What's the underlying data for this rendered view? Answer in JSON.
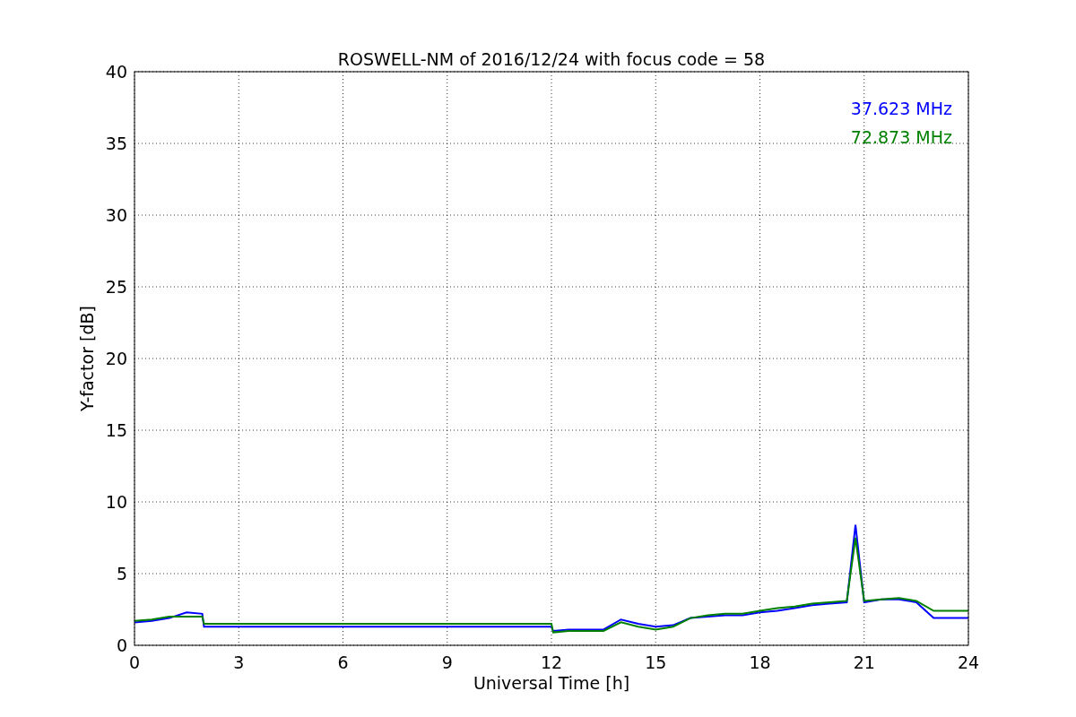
{
  "figure": {
    "chart_data": {
      "type": "line",
      "title": "ROSWELL-NM of 2016/12/24 with focus code = 58",
      "xlabel": "Universal Time [h]",
      "ylabel": "Y-factor [dB]",
      "x": [
        0,
        0.5,
        1,
        1.5,
        1.95,
        2,
        12,
        12.05,
        12.5,
        13,
        13.5,
        14,
        14.5,
        15,
        15.5,
        16,
        16.5,
        17,
        17.5,
        18,
        18.5,
        19,
        19.5,
        20,
        20.5,
        20.75,
        21,
        21.5,
        22,
        22.5,
        23,
        23.5,
        24
      ],
      "series": [
        {
          "name": "37.623 MHz",
          "color": "#0000ff",
          "values": [
            1.6,
            1.7,
            1.9,
            2.3,
            2.2,
            1.3,
            1.3,
            1.0,
            1.1,
            1.1,
            1.1,
            1.8,
            1.5,
            1.3,
            1.4,
            1.9,
            2.0,
            2.1,
            2.1,
            2.3,
            2.4,
            2.6,
            2.8,
            2.9,
            3.0,
            8.4,
            3.0,
            3.2,
            3.2,
            3.0,
            1.9,
            1.9,
            1.9
          ]
        },
        {
          "name": "72.873 MHz",
          "color": "#008000",
          "values": [
            1.7,
            1.8,
            2.0,
            2.0,
            2.0,
            1.5,
            1.5,
            0.9,
            1.0,
            1.0,
            1.0,
            1.6,
            1.3,
            1.1,
            1.3,
            1.9,
            2.1,
            2.2,
            2.2,
            2.4,
            2.6,
            2.7,
            2.9,
            3.0,
            3.1,
            7.5,
            3.1,
            3.2,
            3.3,
            3.1,
            2.4,
            2.4,
            2.4
          ]
        }
      ],
      "grid": true,
      "xlim": [
        0,
        24
      ],
      "ylim": [
        0,
        40
      ],
      "xticks": [
        0,
        3,
        6,
        9,
        12,
        15,
        18,
        21,
        24
      ],
      "yticks": [
        0,
        5,
        10,
        15,
        20,
        25,
        30,
        35,
        40
      ]
    }
  }
}
